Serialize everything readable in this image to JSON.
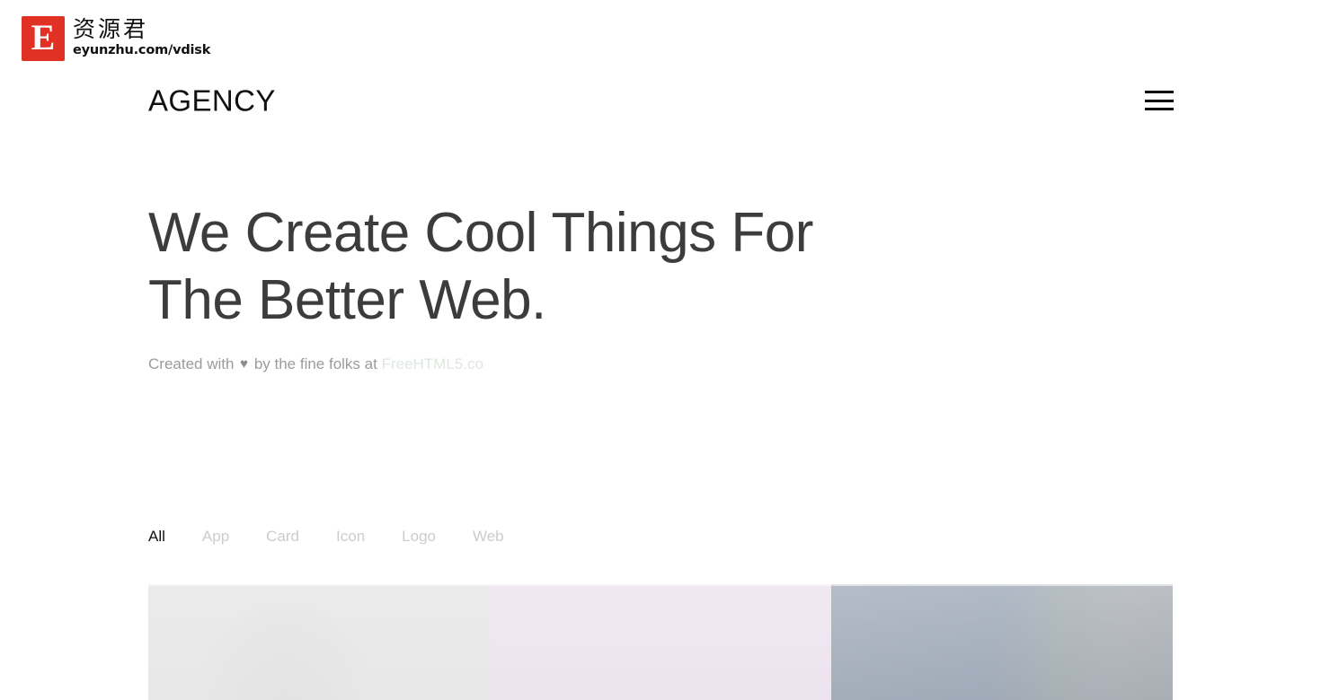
{
  "watermark": {
    "mark_letter": "E",
    "cjk_text": "资源君",
    "url_text": "eyunzhu.com/vdisk",
    "brand_color": "#e13124"
  },
  "nav": {
    "brand": "AGENCY",
    "menu_icon": "hamburger-menu-icon"
  },
  "hero": {
    "title": "We Create Cool Things For The Better Web.",
    "sub_prefix": "Created with",
    "heart": "♥",
    "sub_middle": "by the fine folks at",
    "link_text": "FreeHTML5.co",
    "link_color": "#dfe7e0",
    "title_color": "#3c3c3c",
    "sub_color": "#9b9b9b"
  },
  "filters": {
    "active": "All",
    "items": [
      {
        "label": "All",
        "active": true
      },
      {
        "label": "App",
        "active": false
      },
      {
        "label": "Card",
        "active": false
      },
      {
        "label": "Icon",
        "active": false
      },
      {
        "label": "Logo",
        "active": false
      },
      {
        "label": "Web",
        "active": false
      }
    ]
  },
  "gallery": {
    "tiles": [
      {
        "name": "gallery-tile-1",
        "tone": "#e8e8e8"
      },
      {
        "name": "gallery-tile-2",
        "tone": "#ece3ee"
      },
      {
        "name": "gallery-tile-3",
        "tone": "#ced4dd"
      }
    ]
  }
}
